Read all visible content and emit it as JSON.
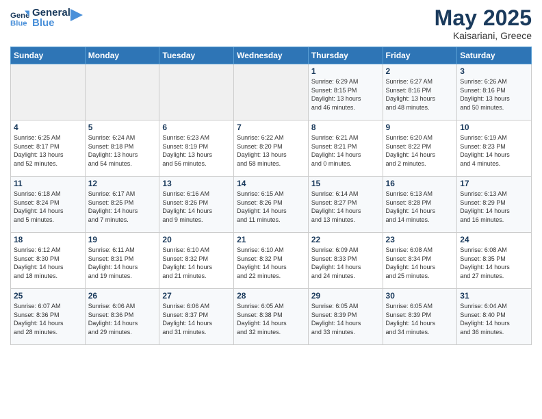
{
  "header": {
    "logo_line1": "General",
    "logo_line2": "Blue",
    "month_year": "May 2025",
    "location": "Kaisariani, Greece"
  },
  "weekdays": [
    "Sunday",
    "Monday",
    "Tuesday",
    "Wednesday",
    "Thursday",
    "Friday",
    "Saturday"
  ],
  "rows": [
    [
      {
        "day": "",
        "info": ""
      },
      {
        "day": "",
        "info": ""
      },
      {
        "day": "",
        "info": ""
      },
      {
        "day": "",
        "info": ""
      },
      {
        "day": "1",
        "info": "Sunrise: 6:29 AM\nSunset: 8:15 PM\nDaylight: 13 hours\nand 46 minutes."
      },
      {
        "day": "2",
        "info": "Sunrise: 6:27 AM\nSunset: 8:16 PM\nDaylight: 13 hours\nand 48 minutes."
      },
      {
        "day": "3",
        "info": "Sunrise: 6:26 AM\nSunset: 8:16 PM\nDaylight: 13 hours\nand 50 minutes."
      }
    ],
    [
      {
        "day": "4",
        "info": "Sunrise: 6:25 AM\nSunset: 8:17 PM\nDaylight: 13 hours\nand 52 minutes."
      },
      {
        "day": "5",
        "info": "Sunrise: 6:24 AM\nSunset: 8:18 PM\nDaylight: 13 hours\nand 54 minutes."
      },
      {
        "day": "6",
        "info": "Sunrise: 6:23 AM\nSunset: 8:19 PM\nDaylight: 13 hours\nand 56 minutes."
      },
      {
        "day": "7",
        "info": "Sunrise: 6:22 AM\nSunset: 8:20 PM\nDaylight: 13 hours\nand 58 minutes."
      },
      {
        "day": "8",
        "info": "Sunrise: 6:21 AM\nSunset: 8:21 PM\nDaylight: 14 hours\nand 0 minutes."
      },
      {
        "day": "9",
        "info": "Sunrise: 6:20 AM\nSunset: 8:22 PM\nDaylight: 14 hours\nand 2 minutes."
      },
      {
        "day": "10",
        "info": "Sunrise: 6:19 AM\nSunset: 8:23 PM\nDaylight: 14 hours\nand 4 minutes."
      }
    ],
    [
      {
        "day": "11",
        "info": "Sunrise: 6:18 AM\nSunset: 8:24 PM\nDaylight: 14 hours\nand 5 minutes."
      },
      {
        "day": "12",
        "info": "Sunrise: 6:17 AM\nSunset: 8:25 PM\nDaylight: 14 hours\nand 7 minutes."
      },
      {
        "day": "13",
        "info": "Sunrise: 6:16 AM\nSunset: 8:26 PM\nDaylight: 14 hours\nand 9 minutes."
      },
      {
        "day": "14",
        "info": "Sunrise: 6:15 AM\nSunset: 8:26 PM\nDaylight: 14 hours\nand 11 minutes."
      },
      {
        "day": "15",
        "info": "Sunrise: 6:14 AM\nSunset: 8:27 PM\nDaylight: 14 hours\nand 13 minutes."
      },
      {
        "day": "16",
        "info": "Sunrise: 6:13 AM\nSunset: 8:28 PM\nDaylight: 14 hours\nand 14 minutes."
      },
      {
        "day": "17",
        "info": "Sunrise: 6:13 AM\nSunset: 8:29 PM\nDaylight: 14 hours\nand 16 minutes."
      }
    ],
    [
      {
        "day": "18",
        "info": "Sunrise: 6:12 AM\nSunset: 8:30 PM\nDaylight: 14 hours\nand 18 minutes."
      },
      {
        "day": "19",
        "info": "Sunrise: 6:11 AM\nSunset: 8:31 PM\nDaylight: 14 hours\nand 19 minutes."
      },
      {
        "day": "20",
        "info": "Sunrise: 6:10 AM\nSunset: 8:32 PM\nDaylight: 14 hours\nand 21 minutes."
      },
      {
        "day": "21",
        "info": "Sunrise: 6:10 AM\nSunset: 8:32 PM\nDaylight: 14 hours\nand 22 minutes."
      },
      {
        "day": "22",
        "info": "Sunrise: 6:09 AM\nSunset: 8:33 PM\nDaylight: 14 hours\nand 24 minutes."
      },
      {
        "day": "23",
        "info": "Sunrise: 6:08 AM\nSunset: 8:34 PM\nDaylight: 14 hours\nand 25 minutes."
      },
      {
        "day": "24",
        "info": "Sunrise: 6:08 AM\nSunset: 8:35 PM\nDaylight: 14 hours\nand 27 minutes."
      }
    ],
    [
      {
        "day": "25",
        "info": "Sunrise: 6:07 AM\nSunset: 8:36 PM\nDaylight: 14 hours\nand 28 minutes."
      },
      {
        "day": "26",
        "info": "Sunrise: 6:06 AM\nSunset: 8:36 PM\nDaylight: 14 hours\nand 29 minutes."
      },
      {
        "day": "27",
        "info": "Sunrise: 6:06 AM\nSunset: 8:37 PM\nDaylight: 14 hours\nand 31 minutes."
      },
      {
        "day": "28",
        "info": "Sunrise: 6:05 AM\nSunset: 8:38 PM\nDaylight: 14 hours\nand 32 minutes."
      },
      {
        "day": "29",
        "info": "Sunrise: 6:05 AM\nSunset: 8:39 PM\nDaylight: 14 hours\nand 33 minutes."
      },
      {
        "day": "30",
        "info": "Sunrise: 6:05 AM\nSunset: 8:39 PM\nDaylight: 14 hours\nand 34 minutes."
      },
      {
        "day": "31",
        "info": "Sunrise: 6:04 AM\nSunset: 8:40 PM\nDaylight: 14 hours\nand 36 minutes."
      }
    ]
  ]
}
